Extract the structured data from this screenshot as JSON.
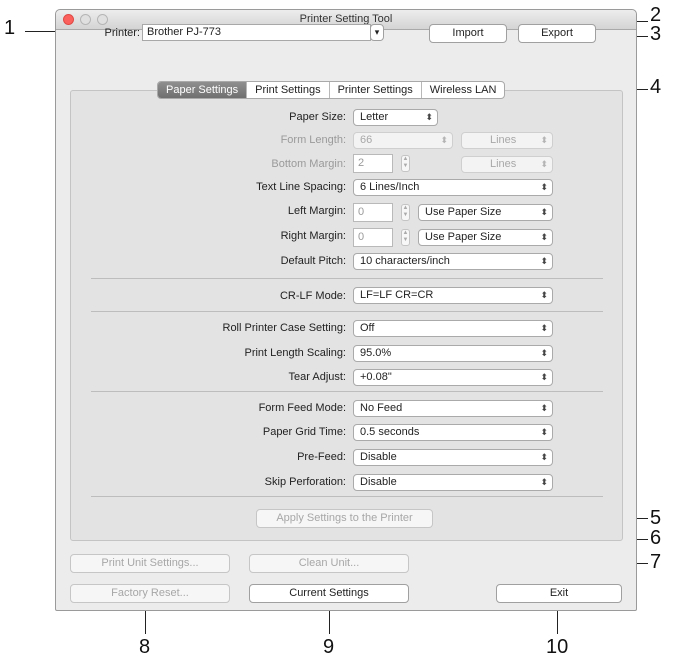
{
  "window": {
    "title": "Printer Setting Tool"
  },
  "header": {
    "printer_label": "Printer:",
    "printer_value": "Brother PJ-773",
    "import_label": "Import",
    "export_label": "Export"
  },
  "tabs": [
    {
      "label": "Paper Settings",
      "active": true
    },
    {
      "label": "Print Settings",
      "active": false
    },
    {
      "label": "Printer Settings",
      "active": false
    },
    {
      "label": "Wireless LAN",
      "active": false
    }
  ],
  "settings": {
    "paper_size": {
      "label": "Paper Size:",
      "value": "Letter"
    },
    "form_length": {
      "label": "Form Length:",
      "value": "66",
      "unit": "Lines"
    },
    "bottom_margin": {
      "label": "Bottom Margin:",
      "value": "2",
      "unit": "Lines"
    },
    "text_line_spacing": {
      "label": "Text Line Spacing:",
      "value": "6 Lines/Inch"
    },
    "left_margin": {
      "label": "Left Margin:",
      "value": "0",
      "unit": "Use Paper Size"
    },
    "right_margin": {
      "label": "Right Margin:",
      "value": "0",
      "unit": "Use Paper Size"
    },
    "default_pitch": {
      "label": "Default Pitch:",
      "value": "10 characters/inch"
    },
    "cr_lf_mode": {
      "label": "CR-LF Mode:",
      "value": "LF=LF CR=CR"
    },
    "roll_printer_case": {
      "label": "Roll Printer Case Setting:",
      "value": "Off"
    },
    "print_length_scaling": {
      "label": "Print Length Scaling:",
      "value": "95.0%"
    },
    "tear_adjust": {
      "label": "Tear Adjust:",
      "value": "+0.08\""
    },
    "form_feed_mode": {
      "label": "Form Feed Mode:",
      "value": "No Feed"
    },
    "paper_grid_time": {
      "label": "Paper Grid Time:",
      "value": "0.5 seconds"
    },
    "pre_feed": {
      "label": "Pre-Feed:",
      "value": "Disable"
    },
    "skip_perforation": {
      "label": "Skip Perforation:",
      "value": "Disable"
    }
  },
  "apply_label": "Apply Settings to the Printer",
  "footer": {
    "print_unit_settings": "Print Unit Settings...",
    "clean_unit": "Clean Unit...",
    "factory_reset": "Factory Reset...",
    "current_settings": "Current Settings",
    "exit": "Exit"
  },
  "callouts": [
    "1",
    "2",
    "3",
    "4",
    "5",
    "6",
    "7",
    "8",
    "9",
    "10"
  ],
  "icons": {
    "popup_arrows": "⬍",
    "combo_arrow": "▾"
  }
}
